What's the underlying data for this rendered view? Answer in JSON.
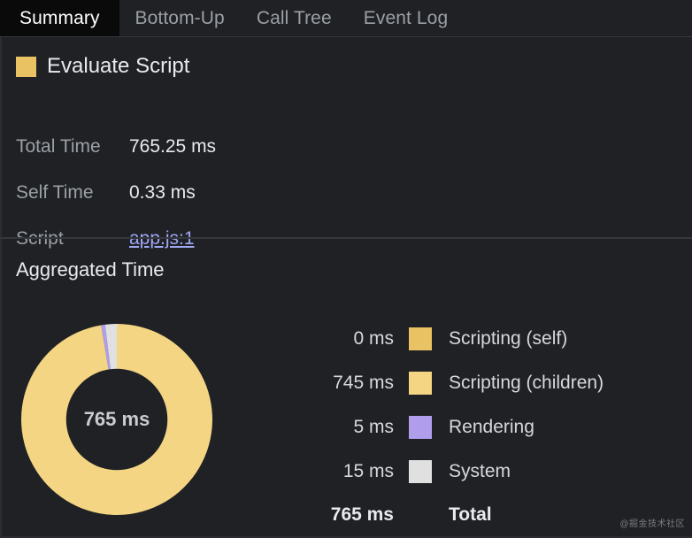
{
  "tabs": [
    {
      "label": "Summary",
      "selected": true
    },
    {
      "label": "Bottom-Up",
      "selected": false
    },
    {
      "label": "Call Tree",
      "selected": false
    },
    {
      "label": "Event Log",
      "selected": false
    }
  ],
  "detail": {
    "swatch_color": "#e8c263",
    "title": "Evaluate Script",
    "rows": [
      {
        "label": "Total Time",
        "value": "765.25 ms",
        "link": false
      },
      {
        "label": "Self Time",
        "value": "0.33 ms",
        "link": false
      },
      {
        "label": "Script",
        "value": "app.js:1",
        "link": true
      }
    ],
    "link_color": "#9fa8f5"
  },
  "aggregated": {
    "title": "Aggregated Time",
    "center_label": "765 ms",
    "total_value": "765 ms",
    "total_label": "Total",
    "legend": [
      {
        "value": "0 ms",
        "label": "Scripting (self)",
        "color": "#e8c263"
      },
      {
        "value": "745 ms",
        "label": "Scripting (children)",
        "color": "#f3d584"
      },
      {
        "value": "5 ms",
        "label": "Rendering",
        "color": "#b09eec"
      },
      {
        "value": "15 ms",
        "label": "System",
        "color": "#e0e0e0"
      }
    ]
  },
  "chart_data": {
    "type": "pie",
    "title": "Aggregated Time",
    "center_label": "765 ms",
    "unit": "ms",
    "donut": true,
    "inner_radius_ratio": 0.53,
    "start_angle_deg": -90,
    "direction": "clockwise",
    "categories": [
      "Scripting (self)",
      "Scripting (children)",
      "Rendering",
      "System"
    ],
    "values": [
      0,
      745,
      5,
      15
    ],
    "colors": [
      "#e8c263",
      "#f3d584",
      "#b09eec",
      "#e0e0e0"
    ],
    "total": 765,
    "legend_position": "right"
  },
  "watermark": "@掘金技术社区"
}
